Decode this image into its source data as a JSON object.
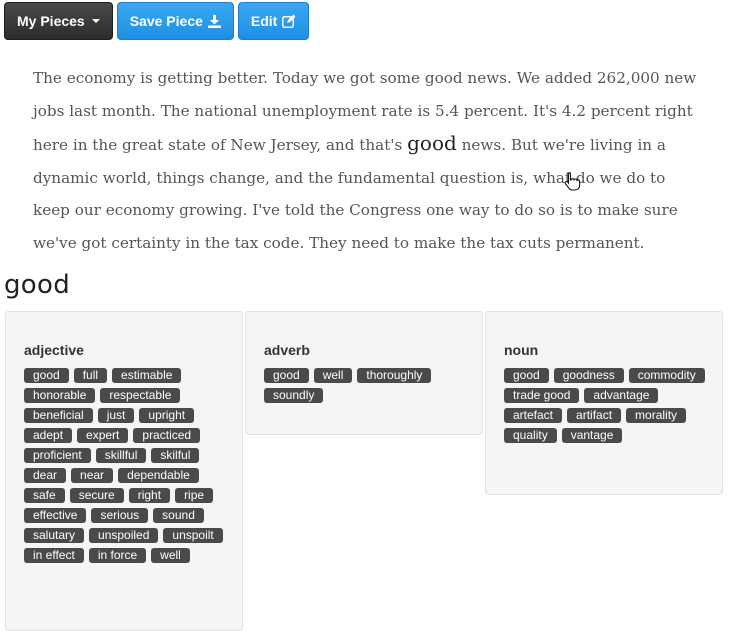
{
  "toolbar": {
    "my_pieces_label": "My Pieces",
    "save_piece_label": "Save Piece",
    "edit_label": "Edit"
  },
  "passage": {
    "before": "The economy is getting better. Today we got some good news. We added 262,000 new jobs last month. The national unemployment rate is 5.4 percent. It's 4.2 percent right here in the great state of New Jersey, and that's ",
    "highlight": "good",
    "after": " news. But we're living in a dynamic world, things change, and the fundamental question is, what do we do to keep our economy growing. I've told the Congress one way to do so is to make sure we've got certainty in the tax code. They need to make the tax cuts permanent."
  },
  "word": "good",
  "groups": [
    {
      "pos": "adjective",
      "synonyms": [
        "good",
        "full",
        "estimable",
        "honorable",
        "respectable",
        "beneficial",
        "just",
        "upright",
        "adept",
        "expert",
        "practiced",
        "proficient",
        "skillful",
        "skilful",
        "dear",
        "near",
        "dependable",
        "safe",
        "secure",
        "right",
        "ripe",
        "effective",
        "serious",
        "sound",
        "salutary",
        "unspoiled",
        "unspoilt",
        "in effect",
        "in force",
        "well"
      ]
    },
    {
      "pos": "adverb",
      "synonyms": [
        "good",
        "well",
        "thoroughly",
        "soundly"
      ]
    },
    {
      "pos": "noun",
      "synonyms": [
        "good",
        "goodness",
        "commodity",
        "trade good",
        "advantage",
        "artefact",
        "artifact",
        "morality",
        "quality",
        "vantage"
      ]
    }
  ],
  "colors": {
    "primary_button": "#2196f3",
    "dark_button": "#333333",
    "tag_background": "#4a4a4a",
    "panel_background": "#f5f5f5"
  }
}
